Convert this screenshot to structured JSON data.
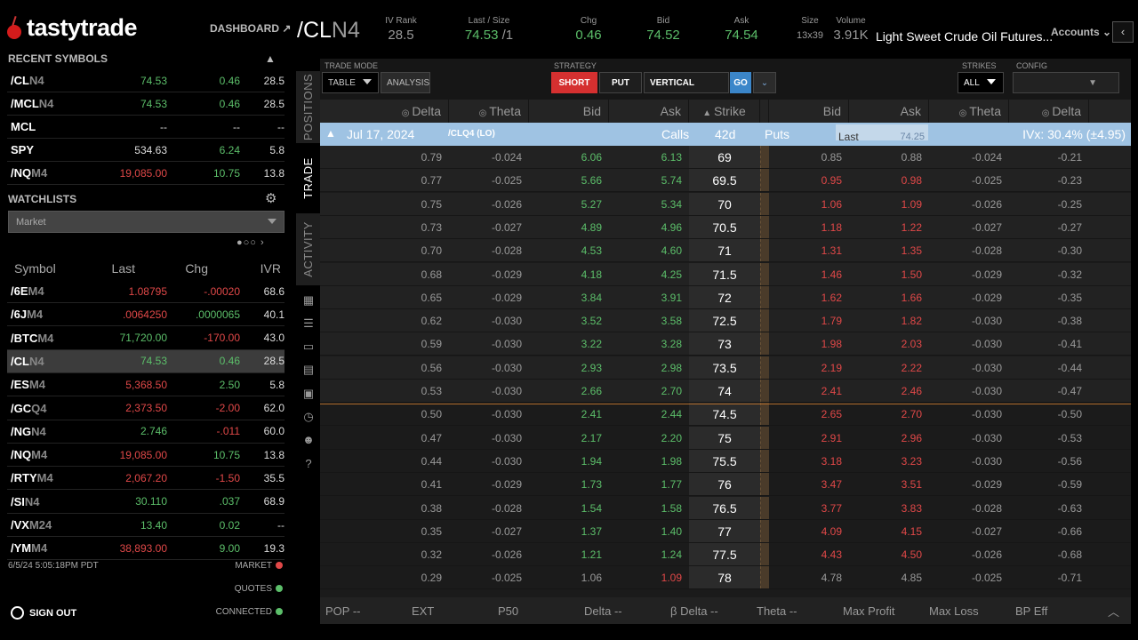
{
  "brand": {
    "name": "tastytrade",
    "dashboard": "DASHBOARD ↗"
  },
  "recent": {
    "title": "RECENT SYMBOLS",
    "rows": [
      {
        "sym": "/CL",
        "dim": "N4",
        "last": "74.53",
        "chg": "0.46",
        "ivr": "28.5",
        "lc": "g",
        "cc": "g"
      },
      {
        "sym": "/MCL",
        "dim": "N4",
        "last": "74.53",
        "chg": "0.46",
        "ivr": "28.5",
        "lc": "g",
        "cc": "g"
      },
      {
        "sym": "MCL",
        "dim": "",
        "last": "--",
        "chg": "--",
        "ivr": "--",
        "lc": "w",
        "cc": "w"
      },
      {
        "sym": "SPY",
        "dim": "",
        "last": "534.63",
        "chg": "6.24",
        "ivr": "5.8",
        "lc": "w",
        "cc": "g"
      },
      {
        "sym": "/NQ",
        "dim": "M4",
        "last": "19,085.00",
        "chg": "10.75",
        "ivr": "13.8",
        "lc": "r",
        "cc": "g"
      }
    ]
  },
  "watchlists": {
    "title": "WATCHLISTS",
    "selected": "Market",
    "pager": "●○○ ›",
    "headers": {
      "symbol": "Symbol",
      "last": "Last",
      "chg": "Chg",
      "ivr": "IVR"
    },
    "rows": [
      {
        "sym": "/6E",
        "dim": "M4",
        "last": "1.08795",
        "chg": "-.00020",
        "ivr": "68.6",
        "lc": "r",
        "cc": "r"
      },
      {
        "sym": "/6J",
        "dim": "M4",
        "last": ".0064250",
        "chg": ".0000065",
        "ivr": "40.1",
        "lc": "r",
        "cc": "g"
      },
      {
        "sym": "/BTC",
        "dim": "M4",
        "last": "71,720.00",
        "chg": "-170.00",
        "ivr": "43.0",
        "lc": "g",
        "cc": "r"
      },
      {
        "sym": "/CL",
        "dim": "N4",
        "last": "74.53",
        "chg": "0.46",
        "ivr": "28.5",
        "lc": "g",
        "cc": "g",
        "sel": true
      },
      {
        "sym": "/ES",
        "dim": "M4",
        "last": "5,368.50",
        "chg": "2.50",
        "ivr": "5.8",
        "lc": "r",
        "cc": "g"
      },
      {
        "sym": "/GC",
        "dim": "Q4",
        "last": "2,373.50",
        "chg": "-2.00",
        "ivr": "62.0",
        "lc": "r",
        "cc": "r"
      },
      {
        "sym": "/NG",
        "dim": "N4",
        "last": "2.746",
        "chg": "-.011",
        "ivr": "60.0",
        "lc": "g",
        "cc": "r"
      },
      {
        "sym": "/NQ",
        "dim": "M4",
        "last": "19,085.00",
        "chg": "10.75",
        "ivr": "13.8",
        "lc": "r",
        "cc": "g"
      },
      {
        "sym": "/RTY",
        "dim": "M4",
        "last": "2,067.20",
        "chg": "-1.50",
        "ivr": "35.5",
        "lc": "r",
        "cc": "r"
      },
      {
        "sym": "/SI",
        "dim": "N4",
        "last": "30.110",
        "chg": ".037",
        "ivr": "68.9",
        "lc": "g",
        "cc": "g"
      },
      {
        "sym": "/VX",
        "dim": "M24",
        "last": "13.40",
        "chg": "0.02",
        "ivr": "--",
        "lc": "g",
        "cc": "g"
      },
      {
        "sym": "/YM",
        "dim": "M4",
        "last": "38,893.00",
        "chg": "9.00",
        "ivr": "19.3",
        "lc": "r",
        "cc": "g"
      }
    ]
  },
  "status": {
    "timestamp": "6/5/24 5:05:18PM PDT",
    "market": "MARKET",
    "quotes": "QUOTES",
    "connected": "CONNECTED",
    "sign_out": "SIGN OUT"
  },
  "quote": {
    "sym": "/CL",
    "dim": "N4",
    "ivrank_label": "IV Rank",
    "ivrank": "28.5",
    "lastsize_label": "Last / Size",
    "last": "74.53",
    "size": "/1",
    "chg_label": "Chg",
    "chg": "0.46",
    "bid_label": "Bid",
    "bid": "74.52",
    "ask_label": "Ask",
    "ask": "74.54",
    "sz_label": "Size",
    "sz": "13x39",
    "vol_label": "Volume",
    "vol": "3.91K",
    "desc": "Light Sweet Crude Oil Futures...",
    "accounts": "Accounts"
  },
  "tabs": {
    "positions": "POSITIONS",
    "trade": "TRADE",
    "activity": "ACTIVITY"
  },
  "toolbar": {
    "trade_mode_label": "TRADE MODE",
    "table": "TABLE",
    "analysis": "ANALYSIS",
    "strategy_label": "STRATEGY",
    "short": "SHORT",
    "put": "PUT",
    "vertical": "VERTICAL",
    "go": "GO",
    "strikes_label": "STRIKES",
    "strikes": "ALL",
    "config_label": "CONFIG"
  },
  "columns": {
    "delta": "Delta",
    "theta": "Theta",
    "bid": "Bid",
    "ask": "Ask",
    "strike": "Strike",
    "pbid": "Bid",
    "pask": "Ask",
    "ptheta": "Theta",
    "pdelta": "Delta"
  },
  "expiration": {
    "date": "Jul 17, 2024",
    "root": "/CLQ4 (LO)",
    "calls": "Calls",
    "dte": "42d",
    "puts": "Puts",
    "last_label": "Last",
    "last_val": "74.25",
    "ivx": "IVx: 30.4% (±4.95)"
  },
  "chain": [
    [
      "0.79",
      "-0.024",
      "6.06",
      "6.13",
      "69",
      "0.85",
      "0.88",
      "-0.024",
      "-0.21"
    ],
    [
      "0.77",
      "-0.025",
      "5.66",
      "5.74",
      "69.5",
      "0.95",
      "0.98",
      "-0.025",
      "-0.23"
    ],
    [
      "0.75",
      "-0.026",
      "5.27",
      "5.34",
      "70",
      "1.06",
      "1.09",
      "-0.026",
      "-0.25"
    ],
    [
      "0.73",
      "-0.027",
      "4.89",
      "4.96",
      "70.5",
      "1.18",
      "1.22",
      "-0.027",
      "-0.27"
    ],
    [
      "0.70",
      "-0.028",
      "4.53",
      "4.60",
      "71",
      "1.31",
      "1.35",
      "-0.028",
      "-0.30"
    ],
    [
      "0.68",
      "-0.029",
      "4.18",
      "4.25",
      "71.5",
      "1.46",
      "1.50",
      "-0.029",
      "-0.32"
    ],
    [
      "0.65",
      "-0.029",
      "3.84",
      "3.91",
      "72",
      "1.62",
      "1.66",
      "-0.029",
      "-0.35"
    ],
    [
      "0.62",
      "-0.030",
      "3.52",
      "3.58",
      "72.5",
      "1.79",
      "1.82",
      "-0.030",
      "-0.38"
    ],
    [
      "0.59",
      "-0.030",
      "3.22",
      "3.28",
      "73",
      "1.98",
      "2.03",
      "-0.030",
      "-0.41"
    ],
    [
      "0.56",
      "-0.030",
      "2.93",
      "2.98",
      "73.5",
      "2.19",
      "2.22",
      "-0.030",
      "-0.44"
    ],
    [
      "0.53",
      "-0.030",
      "2.66",
      "2.70",
      "74",
      "2.41",
      "2.46",
      "-0.030",
      "-0.47"
    ],
    [
      "0.50",
      "-0.030",
      "2.41",
      "2.44",
      "74.5",
      "2.65",
      "2.70",
      "-0.030",
      "-0.50"
    ],
    [
      "0.47",
      "-0.030",
      "2.17",
      "2.20",
      "75",
      "2.91",
      "2.96",
      "-0.030",
      "-0.53"
    ],
    [
      "0.44",
      "-0.030",
      "1.94",
      "1.98",
      "75.5",
      "3.18",
      "3.23",
      "-0.030",
      "-0.56"
    ],
    [
      "0.41",
      "-0.029",
      "1.73",
      "1.77",
      "76",
      "3.47",
      "3.51",
      "-0.029",
      "-0.59"
    ],
    [
      "0.38",
      "-0.028",
      "1.54",
      "1.58",
      "76.5",
      "3.77",
      "3.83",
      "-0.028",
      "-0.63"
    ],
    [
      "0.35",
      "-0.027",
      "1.37",
      "1.40",
      "77",
      "4.09",
      "4.15",
      "-0.027",
      "-0.66"
    ],
    [
      "0.32",
      "-0.026",
      "1.21",
      "1.24",
      "77.5",
      "4.43",
      "4.50",
      "-0.026",
      "-0.68"
    ],
    [
      "0.29",
      "-0.025",
      "1.06",
      "1.09",
      "78",
      "4.78",
      "4.85",
      "-0.025",
      "-0.71"
    ]
  ],
  "footer": {
    "pop": "POP --",
    "ext": "EXT",
    "p50": "P50",
    "delta": "Delta --",
    "bdelta": "β Delta --",
    "theta": "Theta --",
    "maxprofit": "Max Profit",
    "maxloss": "Max Loss",
    "bpeff": "BP Eff"
  },
  "colors": {
    "green": "#5cbf6a",
    "red": "#e04848",
    "accent": "#3b86c9",
    "short": "#d53030"
  }
}
